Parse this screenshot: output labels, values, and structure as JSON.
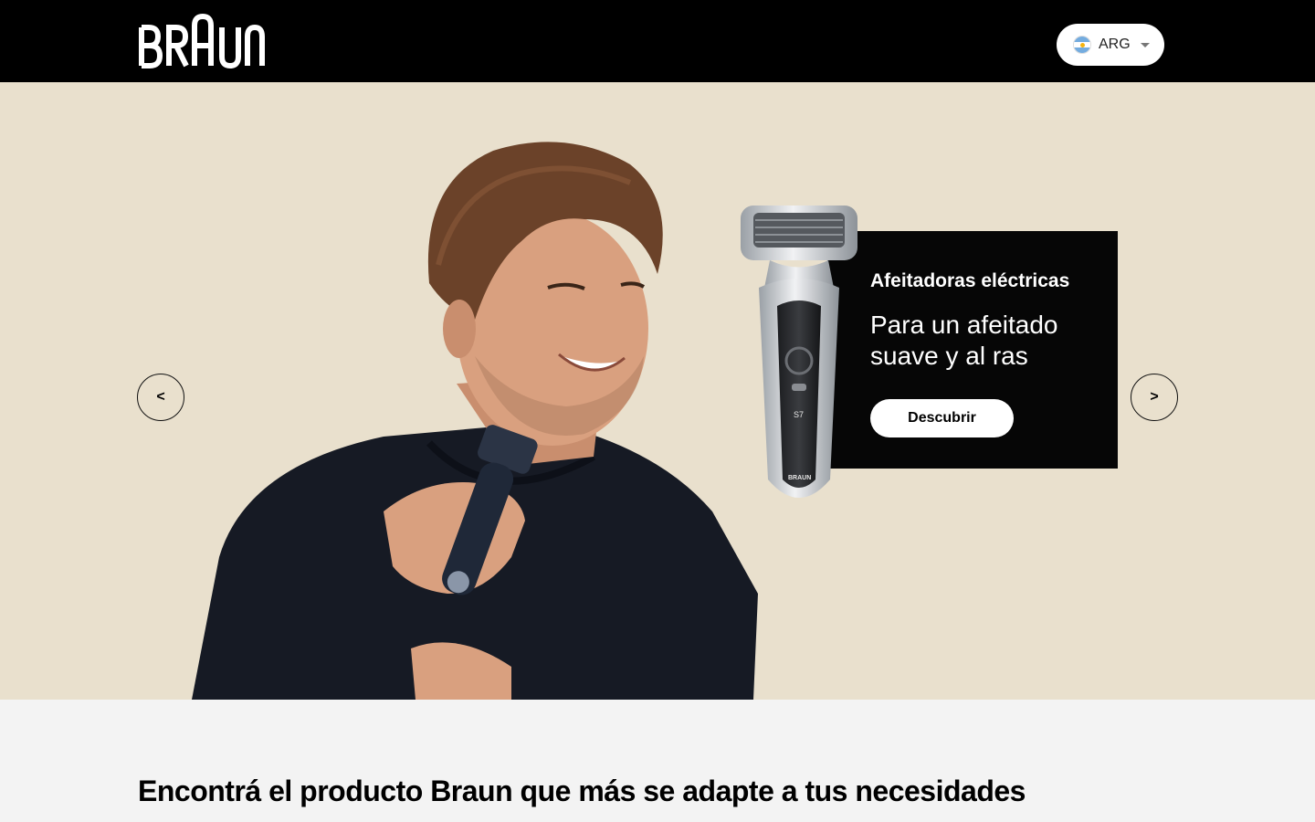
{
  "header": {
    "logo_text": "BRAUN",
    "country_selector": {
      "code": "ARG",
      "flag": "argentina-flag-icon"
    }
  },
  "hero": {
    "prev_label": "<",
    "next_label": ">",
    "promo": {
      "category": "Afeitadoras eléctricas",
      "tagline": "Para un afeitado suave y al ras",
      "button_label": "Descubrir"
    },
    "shaver_model_label": "S7",
    "shaver_brand_label": "BRAUN"
  },
  "section": {
    "title": "Encontrá el producto Braun que más se adapte a tus necesidades"
  },
  "colors": {
    "header_bg": "#000000",
    "hero_bg": "#e9e0cd",
    "card_bg": "#060606",
    "page_bg": "#f3f3f3"
  }
}
